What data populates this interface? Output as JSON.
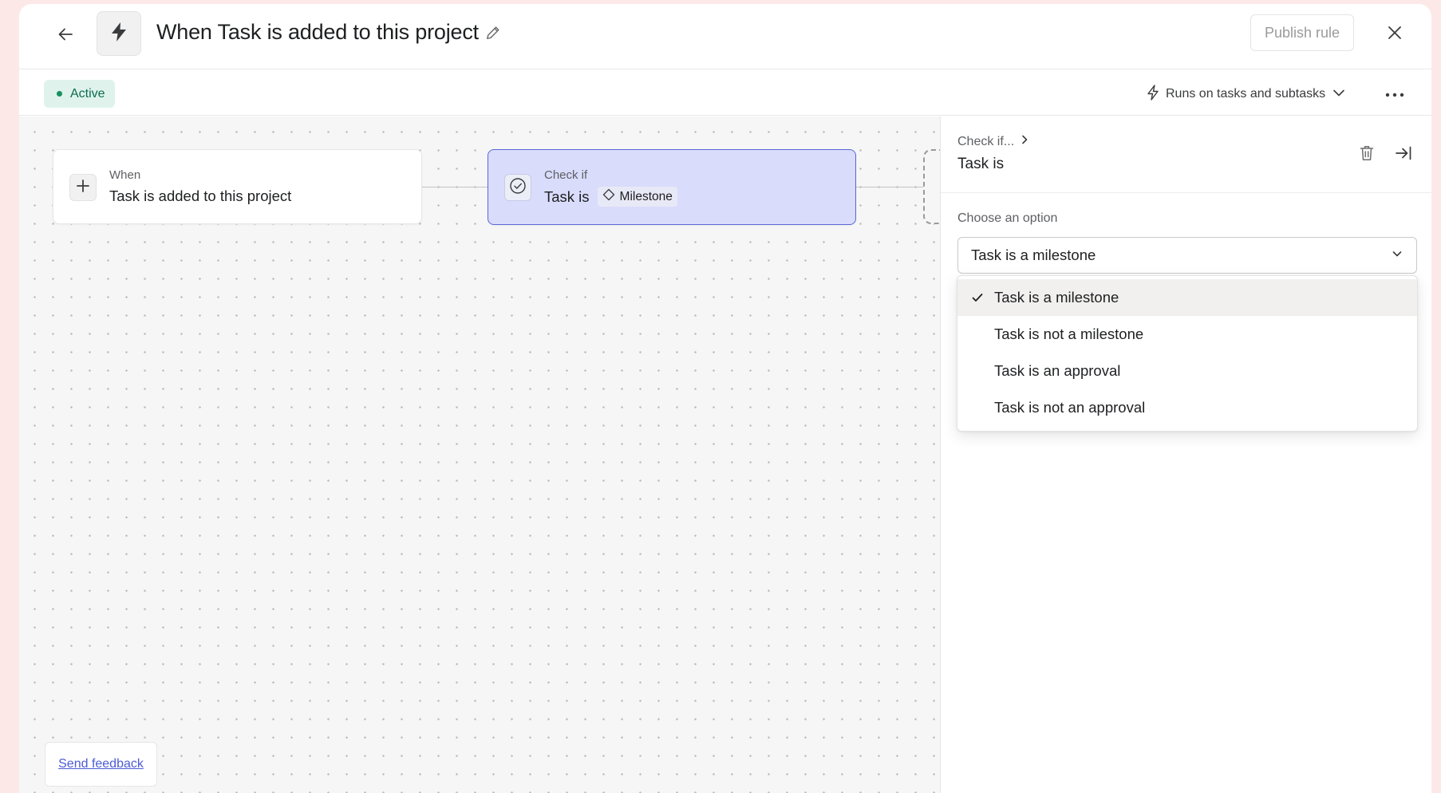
{
  "header": {
    "title": "When Task is added to this project",
    "publish_label": "Publish rule"
  },
  "subbar": {
    "status": "Active",
    "runs_on": "Runs on tasks and subtasks"
  },
  "canvas": {
    "trigger": {
      "kicker": "When",
      "text": "Task is added to this project"
    },
    "condition": {
      "kicker": "Check if",
      "text": "Task is",
      "chip": "Milestone"
    },
    "feedback_link": "Send feedback"
  },
  "panel": {
    "breadcrumb": "Check if...",
    "title": "Task is",
    "field_label": "Choose an option",
    "selected_value": "Task is a milestone",
    "options": [
      {
        "label": "Task is a milestone",
        "selected": true
      },
      {
        "label": "Task is not a milestone",
        "selected": false
      },
      {
        "label": "Task is an approval",
        "selected": false
      },
      {
        "label": "Task is not an approval",
        "selected": false
      }
    ]
  },
  "colors": {
    "active_bg": "#dff3ec",
    "active_text": "#0e6b4f",
    "selected_node_bg": "#d9dcfb",
    "selected_node_border": "#5b67d6",
    "link": "#4c5bd4",
    "page_bg": "#fde8e8"
  },
  "icons": {
    "back": "arrow-left-icon",
    "rule": "lightning-bolt-icon",
    "edit": "pencil-icon",
    "close": "close-x-icon",
    "runs_on": "bolt-outline-icon",
    "chevron": "chevron-down-icon",
    "more": "ellipsis-icon",
    "add": "plus-icon",
    "check_circle": "check-circle-icon",
    "milestone": "diamond-icon",
    "breadcrumb_chevron": "chevron-right-icon",
    "delete": "trash-icon",
    "collapse": "collapse-right-icon",
    "checkmark": "checkmark-icon"
  }
}
